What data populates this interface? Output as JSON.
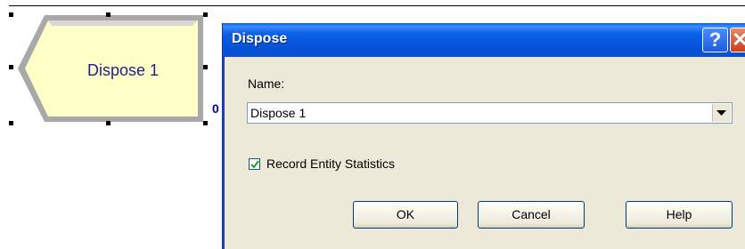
{
  "canvas": {
    "module": {
      "label": "Dispose 1",
      "counter": "0"
    }
  },
  "dialog": {
    "title": "Dispose",
    "help_glyph": "?",
    "close_glyph": "✕",
    "name_label": "Name:",
    "name_value": "Dispose 1",
    "record_stats_label": "Record Entity Statistics",
    "record_stats_checked": true,
    "buttons": {
      "ok": "OK",
      "cancel": "Cancel",
      "help": "Help"
    }
  },
  "colors": {
    "module_fill": "#ffffc8",
    "module_border": "#a0a0a0",
    "titlebar": "#0553d8",
    "dialog_bg": "#ece9d8"
  }
}
